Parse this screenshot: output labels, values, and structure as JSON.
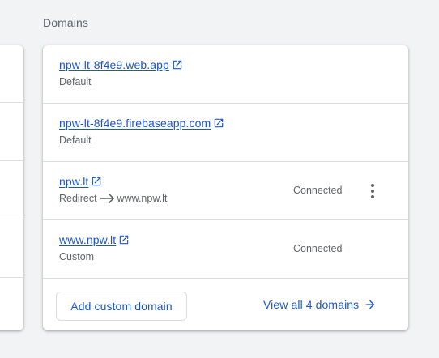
{
  "section": {
    "title": "Domains"
  },
  "domains": [
    {
      "name": "npw-lt-8f4e9.web.app",
      "type": "Default",
      "status": "",
      "redirect_target": ""
    },
    {
      "name": "npw-lt-8f4e9.firebaseapp.com",
      "type": "Default",
      "status": "",
      "redirect_target": ""
    },
    {
      "name": "npw.lt",
      "type": "Redirect",
      "status": "Connected",
      "redirect_target": "www.npw.lt"
    },
    {
      "name": "www.npw.lt",
      "type": "Custom",
      "status": "Connected",
      "redirect_target": ""
    }
  ],
  "actions": {
    "add_custom_domain": "Add custom domain",
    "view_all": "View all 4 domains"
  },
  "icons": {
    "external_link": "open-in-new-icon",
    "redirect_arrow": "arrow-right-icon",
    "more_menu": "more-vert-icon"
  },
  "colors": {
    "link": "#1a56c7",
    "secondary_text": "#5f6368",
    "divider": "#dadce0",
    "background": "#f1f3f4"
  }
}
